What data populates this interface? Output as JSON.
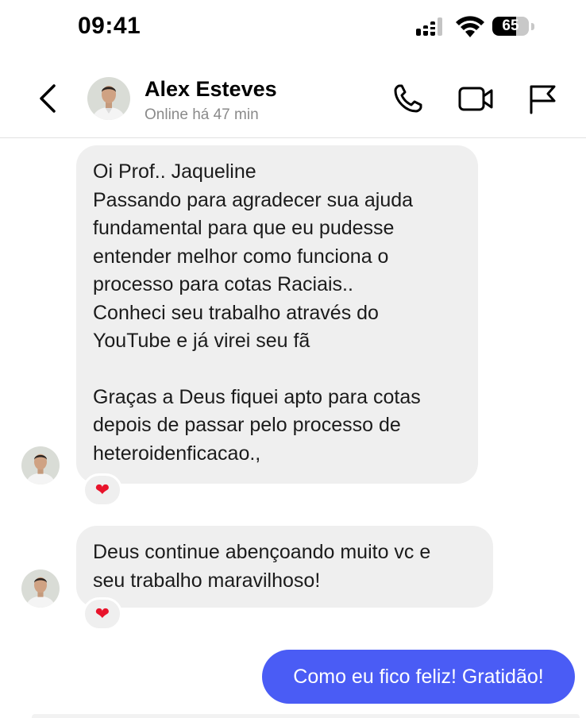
{
  "status_bar": {
    "time": "09:41",
    "battery": "65",
    "battery_level": 0.65
  },
  "header": {
    "contact_name": "Alex Esteves",
    "contact_status": "Online há 47 min"
  },
  "messages": [
    {
      "direction": "incoming",
      "lines": [
        "Oi Prof.. Jaqueline",
        "Passando para agradecer sua ajuda",
        "fundamental para que eu pudesse",
        "entender melhor como funciona o",
        "processo para cotas Raciais..",
        "Conheci seu trabalho através do",
        "YouTube e já virei seu fã",
        "",
        "Graças a Deus fiquei apto para cotas",
        "depois de passar pelo processo de",
        "heteroidenficacao.,"
      ],
      "reaction": "❤"
    },
    {
      "direction": "incoming",
      "lines": [
        "Deus continue abençoando muito vc e",
        "seu trabalho maravilhoso!"
      ],
      "reaction": "❤"
    },
    {
      "direction": "outgoing",
      "text": "Como eu fico feliz! Gratidão!"
    }
  ],
  "colors": {
    "incoming_bubble": "#efefef",
    "outgoing_bubble": "#4a5cf5",
    "reaction_heart": "#e8132b"
  }
}
